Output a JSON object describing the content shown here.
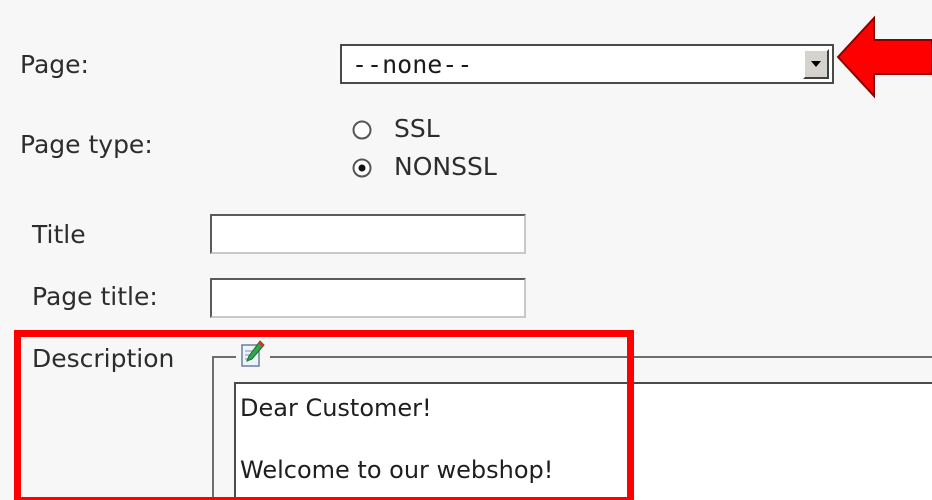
{
  "form": {
    "page_label": "Page:",
    "page_select_value": "--none--",
    "page_type_label": "Page type:",
    "page_type_options": [
      {
        "label": "SSL",
        "selected": false
      },
      {
        "label": "NONSSL",
        "selected": true
      }
    ],
    "title_label": "Title",
    "title_value": "",
    "page_title_label": "Page title:",
    "page_title_value": "",
    "description_label": "Description",
    "description_lines": [
      "Dear Customer!",
      "Welcome to our webshop!"
    ]
  },
  "icons": {
    "edit": "edit-note-icon",
    "dropdown": "chevron-down-icon",
    "annotation_arrow": "red-arrow-icon"
  },
  "colors": {
    "annotation": "#ff0000",
    "background": "#f7f7f7"
  }
}
